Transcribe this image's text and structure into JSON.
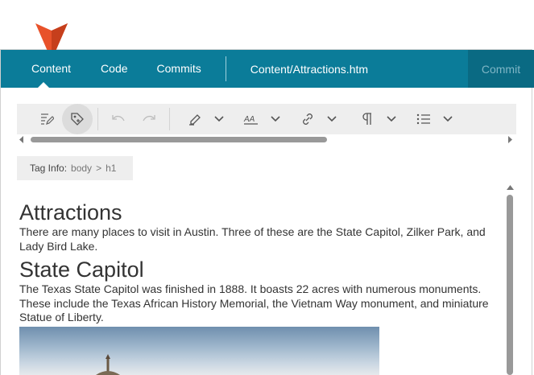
{
  "nav": {
    "tabs": [
      {
        "label": "Content",
        "active": true
      },
      {
        "label": "Code",
        "active": false
      },
      {
        "label": "Commits",
        "active": false
      }
    ],
    "file_path": "Content/Attractions.htm",
    "commit_label": "Commit"
  },
  "toolbar": {
    "icons": [
      "edit-icon",
      "tag-view-icon",
      "undo-icon",
      "redo-icon",
      "highlight-icon",
      "font-style-icon",
      "link-icon",
      "paragraph-icon",
      "list-icon"
    ]
  },
  "tag_info": {
    "label": "Tag Info:",
    "crumbs": [
      "body",
      "h1"
    ],
    "separator": ">"
  },
  "content": {
    "h1_attractions": "Attractions",
    "p_intro": "There are many places to visit in Austin. Three of these are the State Capitol, Zilker Park, and Lady Bird Lake.",
    "h1_capitol": "State Capitol",
    "p_capitol": "The Texas State Capitol was finished in 1888. It boasts 22 acres with numerous monuments. These include the Texas African History Memorial, the Vietnam Way monument, and miniature Statue of Liberty."
  },
  "colors": {
    "nav_bg": "#0b7c99",
    "commit_bg": "#0a6a83",
    "marker": "#e8522a"
  }
}
